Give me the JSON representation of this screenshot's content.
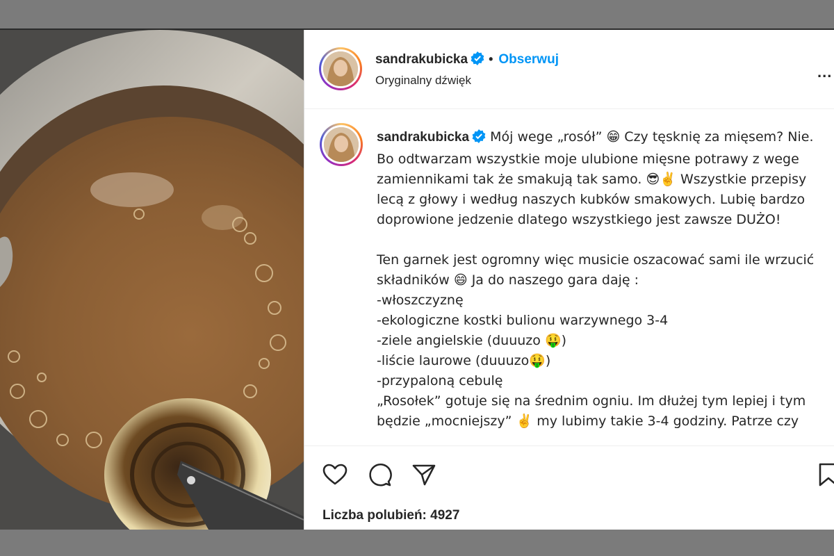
{
  "post": {
    "username": "sandrakubicka",
    "follow_label": "Obserwuj",
    "separator": "•",
    "audio": "Oryginalny dźwięk",
    "more_label": "..."
  },
  "caption": {
    "username": "sandrakubicka",
    "text": " Mój wege „rosół” 😁 Czy tęsknię za mięsem? Nie. Bo odtwarzam wszystkie moje ulubione mięsne potrawy z wege zamiennikami tak że smakują tak samo. 😎✌️ Wszystkie przepisy lecą z głowy i według naszych kubków smakowych. Lubię bardzo doprowione jedzenie dlatego wszystkiego jest zawsze DUŻO!\n\nTen garnek jest ogromny więc musicie oszacować sami ile wrzucić składników 😄 Ja do naszego gara daję :\n-włoszczyznę\n-ekologiczne kostki bulionu warzywnego 3-4\n-ziele angielskie (duuuzo 🤑)\n-liście laurowe (duuuzo🤑)\n-przypaloną cebulę\n„Rosołek” gotuje się na średnim ogniu. Im dłużej tym lepiej i tym będzie „mocniejszy” ✌️ my lubimy takie 3-4 godziny. Patrze czy"
  },
  "stats": {
    "likes_label": "Liczba polubień: 4927"
  },
  "icons": [
    "verified-badge-icon",
    "heart-icon",
    "comment-icon",
    "share-icon",
    "bookmark-icon",
    "more-options-icon"
  ],
  "colors": {
    "link": "#0095f6",
    "text": "#262626",
    "verified": "#0095f6"
  }
}
